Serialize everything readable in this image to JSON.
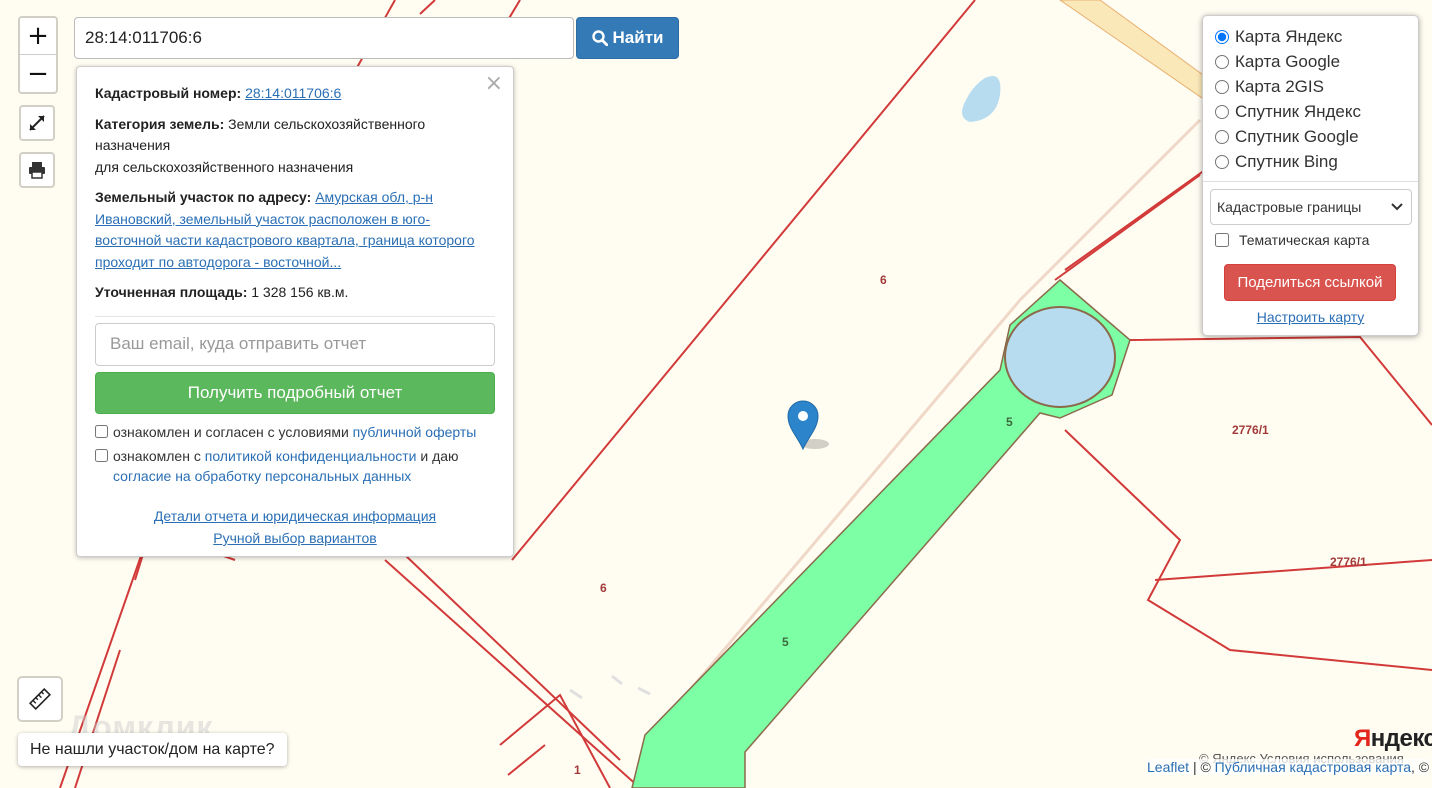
{
  "search": {
    "value": "28:14:011706:6",
    "button_label": "Найти"
  },
  "zoom": {
    "in_label": "+",
    "out_label": "−"
  },
  "map": {
    "parcel_labels": [
      "6",
      "6",
      "5",
      "5",
      "2776/1",
      "2776/1",
      "1"
    ],
    "watermark": "Домклик",
    "colors": {
      "parcel_border": "#d23a3a",
      "water": "#b8dcef",
      "green_zone": "#7dffa5",
      "background": "#fffdf2"
    }
  },
  "popup": {
    "cadastral_label": "Кадастровый номер:",
    "cadastral_value": "28:14:011706:6",
    "category_label": "Категория земель:",
    "category_value": "Земли сельскохозяйственного назначения",
    "category_purpose": "для сельскохозяйственного назначения",
    "address_label": "Земельный участок по адресу:",
    "address_value": "Амурская обл, р-н Ивановский, земельный участок расположен в юго-восточной части кадастрового квартала, граница которого проходит по автодорога - восточной...",
    "area_label": "Уточненная площадь:",
    "area_value": "1 328 156 кв.м.",
    "email_placeholder": "Ваш email, куда отправить отчет",
    "report_button": "Получить подробный отчет",
    "consent1_text": "ознакомлен и согласен с условиями",
    "consent1_link": "публичной оферты",
    "consent2_text": "ознакомлен с",
    "consent2_link": "политикой конфиденциальности",
    "consent2_and": "и даю",
    "consent2_link2": "согласие на обработку персональных данных",
    "details_link": "Детали отчета и юридическая информация",
    "manual_link": "Ручной выбор вариантов",
    "close": "×"
  },
  "layers": {
    "options": [
      "Карта Яндекс",
      "Карта Google",
      "Карта 2GIS",
      "Спутник Яндекс",
      "Спутник Google",
      "Спутник Bing"
    ],
    "selected": "Карта Яндекс",
    "select_value": "Кадастровые границы",
    "thematic_label": "Тематическая карта",
    "share_button": "Поделиться ссылкой",
    "configure_link": "Настроить карту"
  },
  "not_found_button": "Не нашли участок/дом на карте?",
  "attribution": {
    "yandex_logo_y": "Я",
    "yandex_logo_rest": "ндекс",
    "yandex_terms": "© Яндекс  Условия использования",
    "leaflet": "Leaflet",
    "separator": "| ©",
    "pkk": "Публичная кадастровая карта",
    "trailer": ", ©"
  }
}
